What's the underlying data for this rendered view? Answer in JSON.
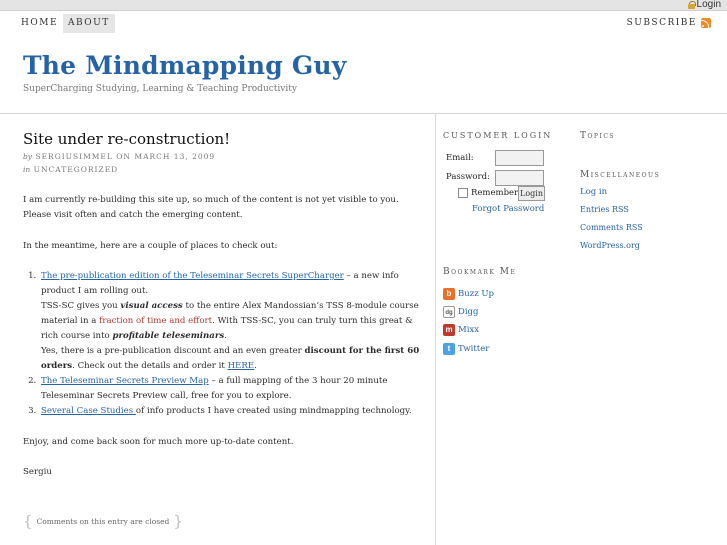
{
  "topbar": {
    "login_label": "Login"
  },
  "nav": {
    "items": [
      {
        "label": "HOME"
      },
      {
        "label": "ABOUT"
      }
    ],
    "subscribe_label": "SUBSCRIBE"
  },
  "site": {
    "title": "The Mindmapping Guy",
    "tagline": "SuperCharging Studying, Learning & Teaching Productivity"
  },
  "post": {
    "title": "Site under re-construction!",
    "meta_by": "by",
    "author": "SERGIUSIMMEL",
    "meta_on": "ON",
    "date": "MARCH 13, 2009",
    "meta_in": "in",
    "category": "UNCATEGORIZED",
    "intro": "I am currently re-building this site up, so much of the content is not yet visible to you. Please visit often and catch the emerging content.",
    "meantime": "In the meantime, here are a couple of places to check out:",
    "items": [
      {
        "link": "The pre-publication edition of the Teleseminar Secrets SuperCharger",
        "text": " – a new info product I am rolling out.",
        "line2_a": "TSS-SC gives you ",
        "line2_em": "visual access",
        "line2_b": " to the entire Alex Mandossian’s TSS 8-module course material in a ",
        "line2_red": "fraction of time and effort",
        "line2_c": ". With TSS-SC, you can  truly turn this great &  rich course into ",
        "line2_em2": "profitable teleseminars",
        "line2_d": ".",
        "line3_a": "Yes, there is a pre-publication discount and an even greater ",
        "line3_bold": "discount for the first 60 orders",
        "line3_b": ". Check out the details and order it ",
        "line3_link": "HERE",
        "line3_c": "."
      },
      {
        "link": "The Teleseminar Secrets Preview Map",
        "text": " – a full mapping of the 3 hour 20 minute Teleseminar Secrets Preview call, free for you to explore."
      },
      {
        "link": "Several Case Studies ",
        "text": "of info products I have created using mindmapping technology."
      }
    ],
    "closing": "Enjoy, and come back soon for much more up-to-date content.",
    "signature": "Sergiu",
    "comments_closed": "Comments on this entry are closed"
  },
  "login_widget": {
    "title": "CUSTOMER LOGIN",
    "email_label": "Email:",
    "password_label": "Password:",
    "remember_label": "Remember",
    "login_button": "Login",
    "forgot_label": "Forgot Password"
  },
  "bookmark": {
    "title": "Bookmark Me",
    "items": [
      {
        "label": "Buzz Up",
        "icon": "yahoo-buzz-icon",
        "color": "#e8702a",
        "glyph": "b"
      },
      {
        "label": "Digg",
        "icon": "digg-icon",
        "color": "#ffffff",
        "glyph": ""
      },
      {
        "label": "Mixx",
        "icon": "mixx-icon",
        "color": "#c0392b",
        "glyph": "m"
      },
      {
        "label": "Twitter",
        "icon": "twitter-icon",
        "color": "#4aa3df",
        "glyph": "t"
      }
    ]
  },
  "topics": {
    "title": "Topics"
  },
  "misc": {
    "title": "Miscellaneous",
    "items": [
      {
        "label": "Log in"
      },
      {
        "label": "Entries RSS"
      },
      {
        "label": "Comments RSS"
      },
      {
        "label": "WordPress.org"
      }
    ]
  },
  "colors": {
    "accent": "#2563a6",
    "highlight_red": "#b03a2e"
  }
}
